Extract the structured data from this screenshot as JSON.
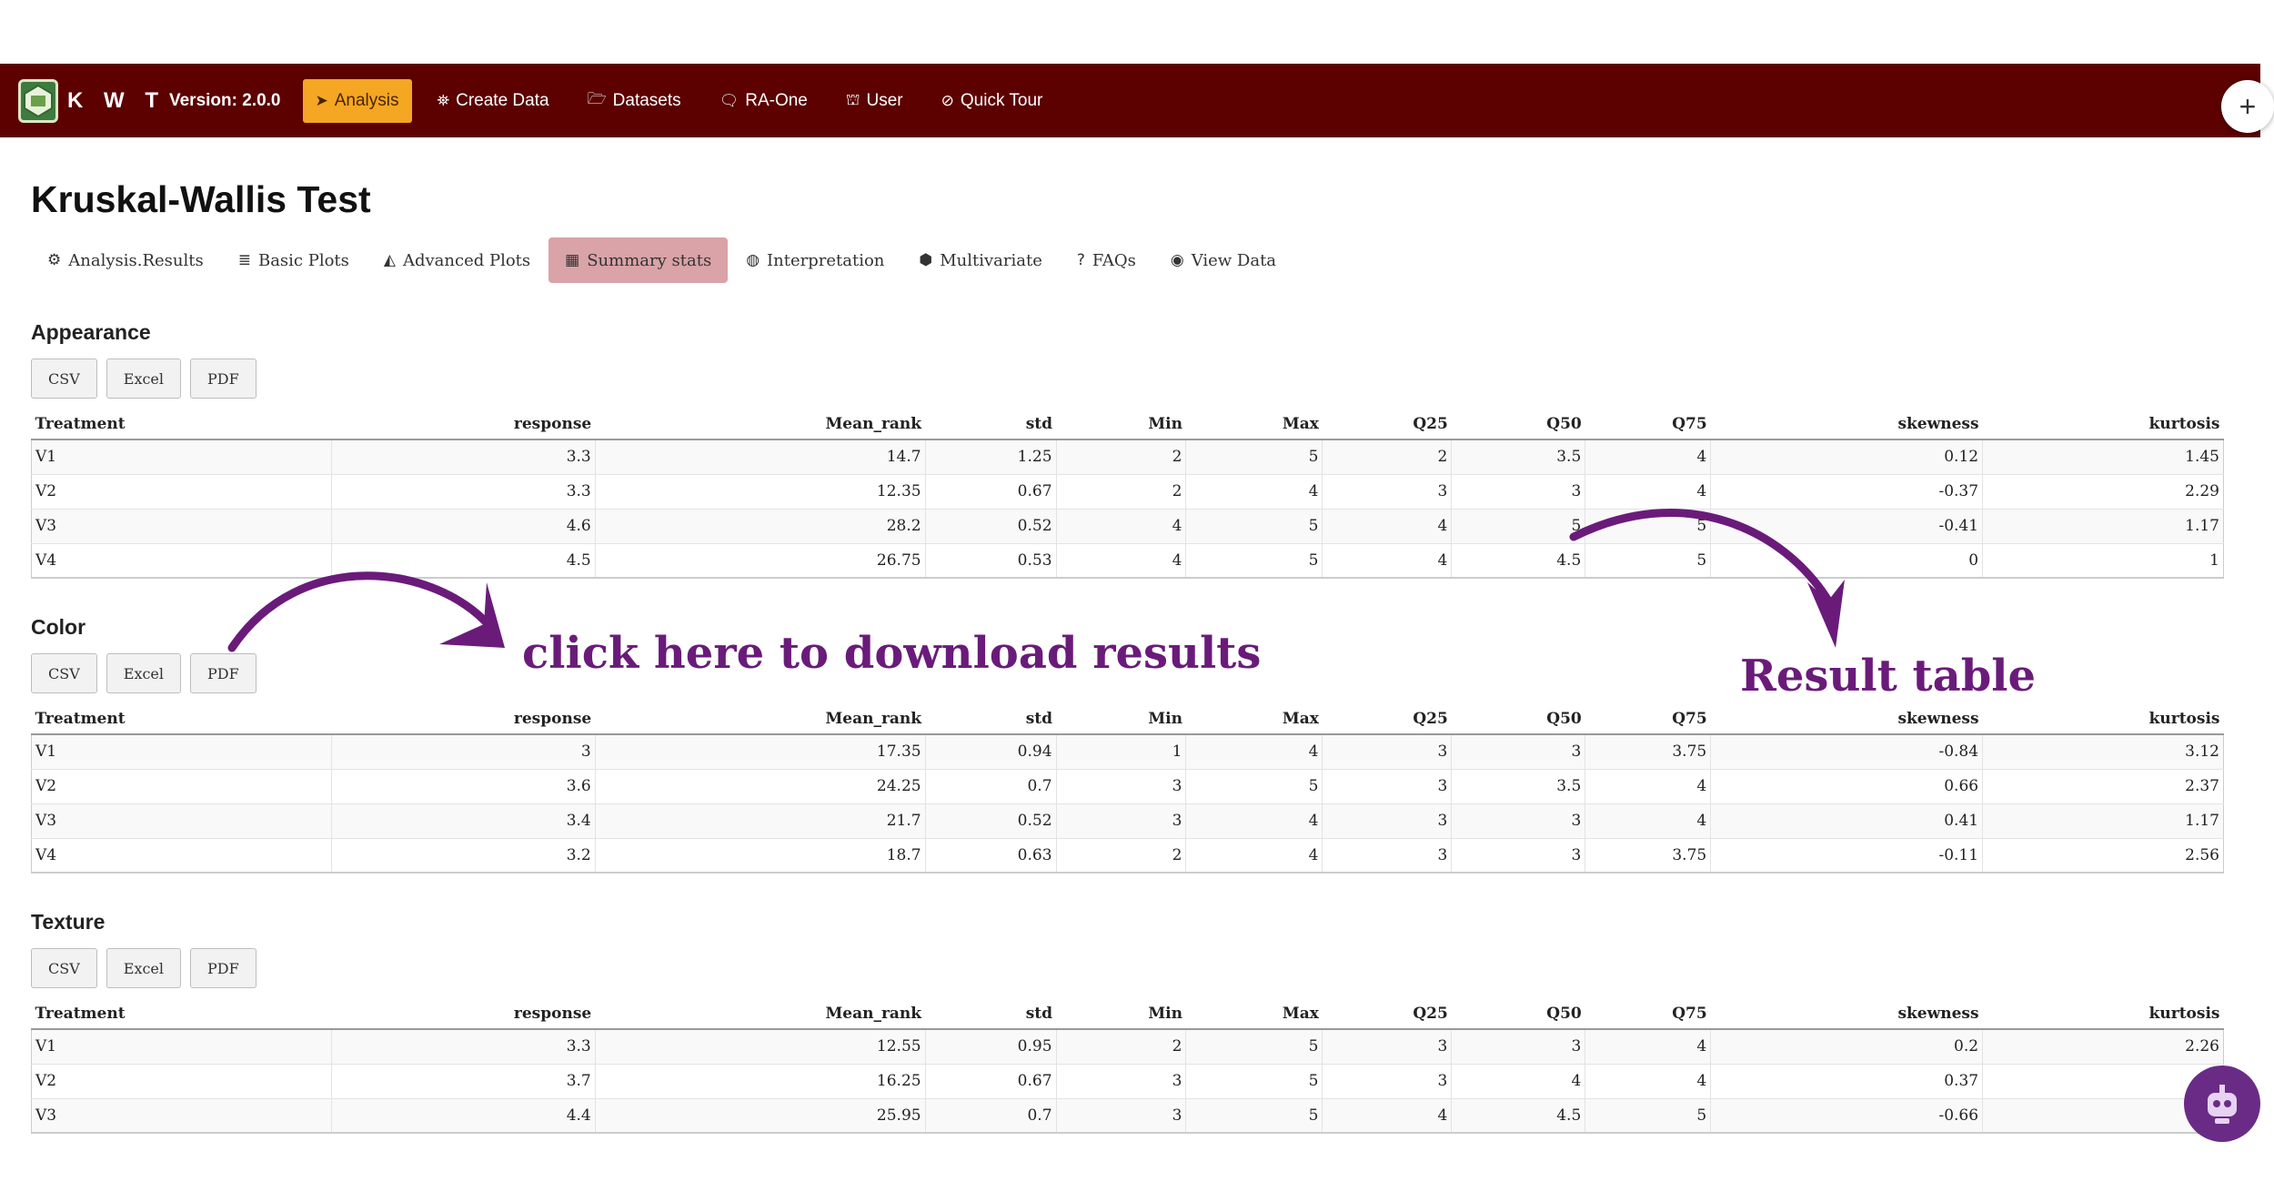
{
  "navbar": {
    "brand_name": "K W T",
    "version": "Version: 2.0.0",
    "items": [
      {
        "label": "Analysis",
        "icon": "paper-plane-icon",
        "glyph": "➤",
        "active": true
      },
      {
        "label": "Create Data",
        "icon": "binoculars-icon",
        "glyph": "⛯",
        "active": false
      },
      {
        "label": "Datasets",
        "icon": "folder-open-icon",
        "glyph": "🗁",
        "active": false
      },
      {
        "label": "RA-One",
        "icon": "comment-icon",
        "glyph": "🗨",
        "active": false
      },
      {
        "label": "User",
        "icon": "user-icon",
        "glyph": "⛫",
        "active": false
      },
      {
        "label": "Quick Tour",
        "icon": "compass-icon",
        "glyph": "⊘",
        "active": false
      }
    ],
    "plus_label": "+"
  },
  "page_title": "Kruskal-Wallis Test",
  "tabs": [
    {
      "label": "Analysis.Results",
      "icon": "cogs-icon",
      "glyph": "⚙",
      "active": false
    },
    {
      "label": "Basic Plots",
      "icon": "bar-chart-icon",
      "glyph": "≣",
      "active": false
    },
    {
      "label": "Advanced Plots",
      "icon": "area-chart-icon",
      "glyph": "◭",
      "active": false
    },
    {
      "label": "Summary stats",
      "icon": "table-icon",
      "glyph": "▦",
      "active": true
    },
    {
      "label": "Interpretation",
      "icon": "compass-icon",
      "glyph": "◍",
      "active": false
    },
    {
      "label": "Multivariate",
      "icon": "cubes-icon",
      "glyph": "⬢",
      "active": false
    },
    {
      "label": "FAQs",
      "icon": "question-icon",
      "glyph": "?",
      "active": false
    },
    {
      "label": "View Data",
      "icon": "eye-icon",
      "glyph": "◉",
      "active": false
    }
  ],
  "export_buttons": {
    "csv": "CSV",
    "excel": "Excel",
    "pdf": "PDF"
  },
  "columns": [
    "Treatment",
    "response",
    "Mean_rank",
    "std",
    "Min",
    "Max",
    "Q25",
    "Q50",
    "Q75",
    "skewness",
    "kurtosis"
  ],
  "sections": [
    {
      "title": "Appearance",
      "rows": [
        [
          "V1",
          "3.3",
          "14.7",
          "1.25",
          "2",
          "5",
          "2",
          "3.5",
          "4",
          "0.12",
          "1.45"
        ],
        [
          "V2",
          "3.3",
          "12.35",
          "0.67",
          "2",
          "4",
          "3",
          "3",
          "4",
          "-0.37",
          "2.29"
        ],
        [
          "V3",
          "4.6",
          "28.2",
          "0.52",
          "4",
          "5",
          "4",
          "5",
          "5",
          "-0.41",
          "1.17"
        ],
        [
          "V4",
          "4.5",
          "26.75",
          "0.53",
          "4",
          "5",
          "4",
          "4.5",
          "5",
          "0",
          "1"
        ]
      ]
    },
    {
      "title": "Color",
      "rows": [
        [
          "V1",
          "3",
          "17.35",
          "0.94",
          "1",
          "4",
          "3",
          "3",
          "3.75",
          "-0.84",
          "3.12"
        ],
        [
          "V2",
          "3.6",
          "24.25",
          "0.7",
          "3",
          "5",
          "3",
          "3.5",
          "4",
          "0.66",
          "2.37"
        ],
        [
          "V3",
          "3.4",
          "21.7",
          "0.52",
          "3",
          "4",
          "3",
          "3",
          "4",
          "0.41",
          "1.17"
        ],
        [
          "V4",
          "3.2",
          "18.7",
          "0.63",
          "2",
          "4",
          "3",
          "3",
          "3.75",
          "-0.11",
          "2.56"
        ]
      ]
    },
    {
      "title": "Texture",
      "rows": [
        [
          "V1",
          "3.3",
          "12.55",
          "0.95",
          "2",
          "5",
          "3",
          "3",
          "4",
          "0.2",
          "2.26"
        ],
        [
          "V2",
          "3.7",
          "16.25",
          "0.67",
          "3",
          "5",
          "3",
          "4",
          "4",
          "0.37",
          ""
        ],
        [
          "V3",
          "4.4",
          "25.95",
          "0.7",
          "3",
          "5",
          "4",
          "4.5",
          "5",
          "-0.66",
          ""
        ]
      ]
    }
  ],
  "annotations": {
    "download": "click here to download results",
    "result_table": "Result table"
  }
}
